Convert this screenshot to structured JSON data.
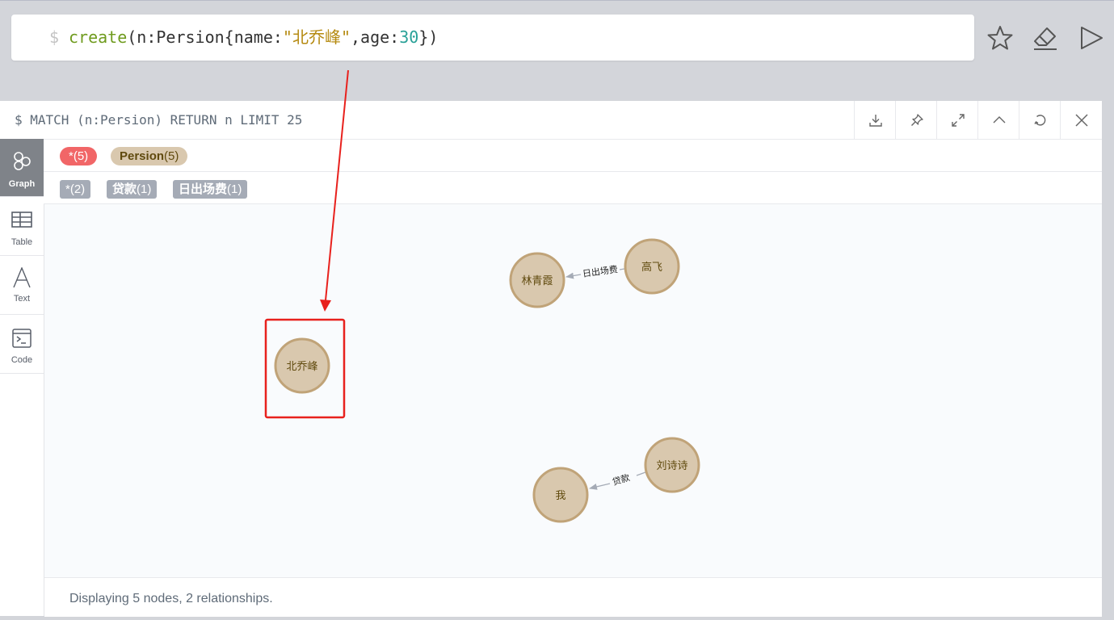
{
  "editor": {
    "prompt": "$",
    "code_keyword": "create",
    "code_part1": "(n:Persion{name:",
    "code_string": "\"北乔峰\"",
    "code_part2": ",age:",
    "code_number": "30",
    "code_part3": "})",
    "buttons": {
      "favorite": "star-icon",
      "clear": "eraser-icon",
      "run": "play-icon"
    }
  },
  "frame": {
    "query": "$ MATCH (n:Persion) RETURN n LIMIT 25",
    "buttons": [
      "download-icon",
      "pin-icon",
      "expand-icon",
      "collapse-icon",
      "rerun-icon",
      "close-icon"
    ]
  },
  "sidebar": {
    "items": [
      {
        "label": "Graph",
        "icon": "graph-icon",
        "active": true
      },
      {
        "label": "Table",
        "icon": "table-icon",
        "active": false
      },
      {
        "label": "Text",
        "icon": "text-icon",
        "active": false
      },
      {
        "label": "Code",
        "icon": "code-icon",
        "active": false
      }
    ]
  },
  "node_labels": [
    {
      "name": "*",
      "count": "(5)",
      "color": "#f16667"
    },
    {
      "name": "Persion",
      "count": "(5)",
      "color": "#d9c8ae"
    }
  ],
  "relationship_types": [
    {
      "name": "*",
      "count": "(2)"
    },
    {
      "name": "贷款",
      "count": "(1)"
    },
    {
      "name": "日出场费",
      "count": "(1)"
    }
  ],
  "graph": {
    "nodes": [
      {
        "id": "linqingxia",
        "label": "林青霞"
      },
      {
        "id": "gaofei",
        "label": "高飞"
      },
      {
        "id": "beiqiaofeng",
        "label": "北乔峰"
      },
      {
        "id": "liushishi",
        "label": "刘诗诗"
      },
      {
        "id": "wo",
        "label": "我"
      }
    ],
    "relationships": [
      {
        "from": "gaofei",
        "to": "linqingxia",
        "type": "日出场费"
      },
      {
        "from": "liushishi",
        "to": "wo",
        "type": "贷款"
      }
    ],
    "node_fill": "#d9c8ae",
    "node_stroke": "#c0a378",
    "node_text_color": "#604a0e"
  },
  "annotation_color": "#e8211d",
  "footer": {
    "status": "Displaying 5 nodes, 2 relationships."
  }
}
